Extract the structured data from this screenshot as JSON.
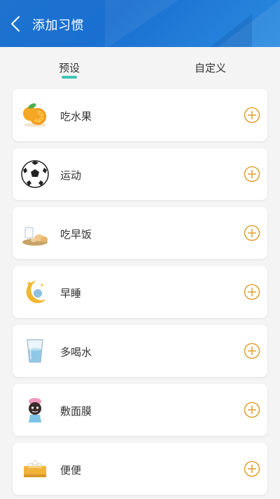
{
  "header": {
    "title": "添加习惯",
    "back_icon": "back-arrow-icon"
  },
  "tabs": [
    {
      "label": "预设",
      "active": true
    },
    {
      "label": "自定义",
      "active": false
    }
  ],
  "habits": [
    {
      "label": "吃水果",
      "icon": "orange-icon"
    },
    {
      "label": "运动",
      "icon": "soccer-ball-icon"
    },
    {
      "label": "吃早饭",
      "icon": "breakfast-icon"
    },
    {
      "label": "早睡",
      "icon": "moon-icon"
    },
    {
      "label": "多喝水",
      "icon": "water-glass-icon"
    },
    {
      "label": "敷面膜",
      "icon": "face-mask-icon"
    },
    {
      "label": "便便",
      "icon": "tissue-box-icon"
    }
  ],
  "colors": {
    "header": "#1e73cf",
    "accent": "#e0a43a",
    "tab_indicator": "#3ec5b4",
    "background": "#f4f4f4"
  }
}
